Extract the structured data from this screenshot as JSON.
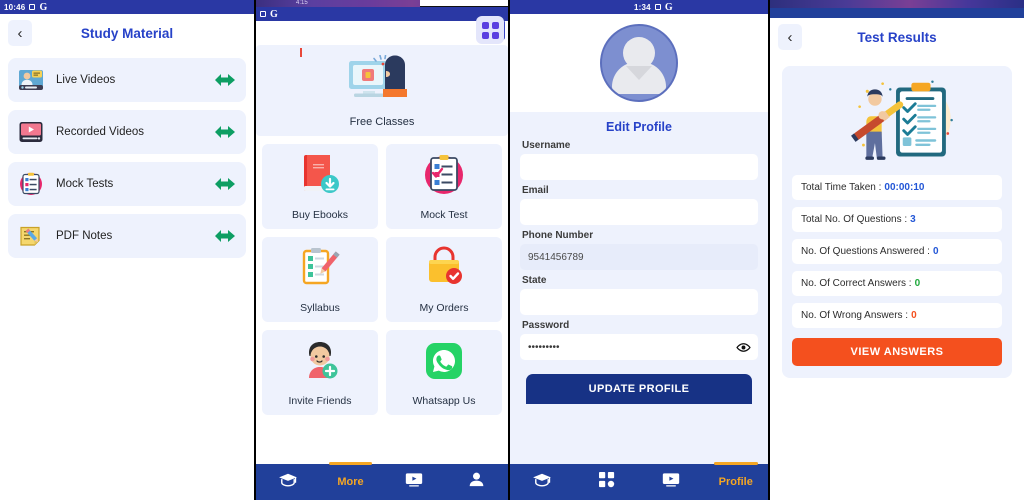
{
  "panels": {
    "study_material": {
      "statusbar": {
        "clock": "10:46",
        "icons": [
          "screenshot-icon",
          "google-icon"
        ]
      },
      "header": {
        "back": "‹",
        "title": "Study Material"
      },
      "items": [
        {
          "label": "Live Videos",
          "icon": "live-video-icon",
          "arrow": "green-arrow-icon"
        },
        {
          "label": "Recorded Videos",
          "icon": "recorded-video-icon",
          "arrow": "green-arrow-icon"
        },
        {
          "label": "Mock Tests",
          "icon": "mock-test-icon",
          "arrow": "green-arrow-icon"
        },
        {
          "label": "PDF Notes",
          "icon": "pdf-notes-icon",
          "arrow": "green-arrow-icon"
        }
      ]
    },
    "home_grid": {
      "statusbar": {
        "clock": "",
        "icons": [
          "screenshot-icon",
          "google-icon"
        ]
      },
      "ghost_text": "4:15",
      "featured": {
        "label": "Free Classes",
        "icon": "free-classes-icon"
      },
      "tiles": [
        {
          "label": "Buy Ebooks",
          "icon": "buy-ebooks-icon"
        },
        {
          "label": "Mock Test",
          "icon": "mock-test-icon"
        },
        {
          "label": "Syllabus",
          "icon": "syllabus-icon"
        },
        {
          "label": "My Orders",
          "icon": "my-orders-icon"
        },
        {
          "label": "Invite Friends",
          "icon": "invite-friends-icon"
        },
        {
          "label": "Whatsapp Us",
          "icon": "whatsapp-icon"
        }
      ],
      "bottomnav": [
        {
          "label": "",
          "icon": "graduation-cap-icon",
          "active": false
        },
        {
          "label": "More",
          "icon": "",
          "active": true
        },
        {
          "label": "",
          "icon": "video-icon",
          "active": false
        },
        {
          "label": "",
          "icon": "person-icon",
          "active": false
        }
      ]
    },
    "edit_profile": {
      "statusbar": {
        "clock": "1:34",
        "icons": [
          "screenshot-icon",
          "google-icon"
        ]
      },
      "avatar": "default-avatar-icon",
      "title": "Edit Profile",
      "fields": [
        {
          "label": "Username",
          "value": "",
          "placeholder": "",
          "filled": false
        },
        {
          "label": "Email",
          "value": "",
          "placeholder": "",
          "filled": false
        },
        {
          "label": "Phone Number",
          "value": "9541456789",
          "placeholder": "",
          "filled": true
        },
        {
          "label": "State",
          "value": "",
          "placeholder": "",
          "filled": false
        },
        {
          "label": "Password",
          "value": "•••••••••",
          "placeholder": "",
          "filled": false
        }
      ],
      "submit_label": "UPDATE PROFILE",
      "bottomnav": [
        {
          "label": "",
          "icon": "graduation-cap-icon",
          "active": false
        },
        {
          "label": "",
          "icon": "grid-icon",
          "active": false
        },
        {
          "label": "",
          "icon": "video-icon",
          "active": false
        },
        {
          "label": "Profile",
          "icon": "",
          "active": true
        }
      ]
    },
    "test_results": {
      "header": {
        "back": "‹",
        "title": "Test Results"
      },
      "illustration": "test-results-illustration",
      "rows": [
        {
          "label": "Total Time Taken : ",
          "value": "00:00:10",
          "value_color": "#2256d6"
        },
        {
          "label": "Total No. Of Questions : ",
          "value": "3",
          "value_color": "#2256d6"
        },
        {
          "label": "No. Of Questions Answered : ",
          "value": "0",
          "value_color": "#2256d6"
        },
        {
          "label": "No. Of Correct Answers : ",
          "value": "0",
          "value_color": "#1fa83c"
        },
        {
          "label": "No. Of Wrong Answers : ",
          "value": "0",
          "value_color": "#f4501e"
        }
      ],
      "view_answers_label": "VIEW ANSWERS"
    }
  },
  "colors": {
    "brand_blue": "#21409a",
    "title_blue": "#2742c8",
    "card_bg": "#eef2fd",
    "accent_orange": "#f4501e",
    "nav_active": "#f5a623",
    "green_arrow": "#0d9e63"
  }
}
